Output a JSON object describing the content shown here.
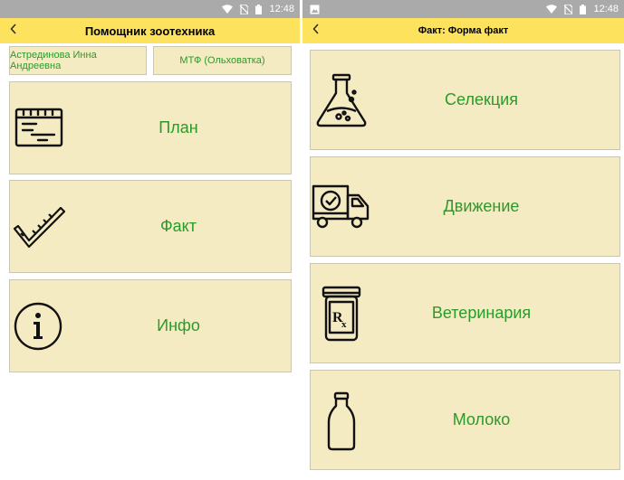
{
  "status": {
    "time": "12:48"
  },
  "left": {
    "title": "Помощник зоотехника",
    "user": "Астрединова Инна Андреевна",
    "farm": "МТФ (Ольховатка)",
    "menu": [
      {
        "label": "План",
        "icon": "calendar-list-icon"
      },
      {
        "label": "Факт",
        "icon": "checkmark-ruler-icon"
      },
      {
        "label": "Инфо",
        "icon": "info-icon"
      }
    ]
  },
  "right": {
    "title": "Факт: Форма факт",
    "menu": [
      {
        "label": "Селекция",
        "icon": "lab-flask-icon"
      },
      {
        "label": "Движение",
        "icon": "delivery-truck-icon"
      },
      {
        "label": "Ветеринария",
        "icon": "prescription-jar-icon"
      },
      {
        "label": "Молоко",
        "icon": "milk-bottle-icon"
      }
    ]
  },
  "colors": {
    "appbar": "#fde25e",
    "card": "#f5ebc3",
    "label": "#2a9a2a",
    "statusbar": "#aaaaaa"
  }
}
